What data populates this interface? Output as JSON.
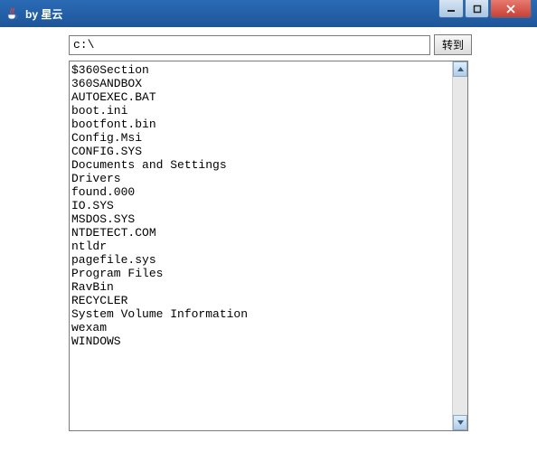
{
  "window": {
    "title": "by 星云"
  },
  "toolbar": {
    "path_value": "c:\\",
    "go_label": "转到"
  },
  "files": [
    "$360Section",
    "360SANDBOX",
    "AUTOEXEC.BAT",
    "boot.ini",
    "bootfont.bin",
    "Config.Msi",
    "CONFIG.SYS",
    "Documents and Settings",
    "Drivers",
    "found.000",
    "IO.SYS",
    "MSDOS.SYS",
    "NTDETECT.COM",
    "ntldr",
    "pagefile.sys",
    "Program Files",
    "RavBin",
    "RECYCLER",
    "System Volume Information",
    "wexam",
    "WINDOWS"
  ]
}
